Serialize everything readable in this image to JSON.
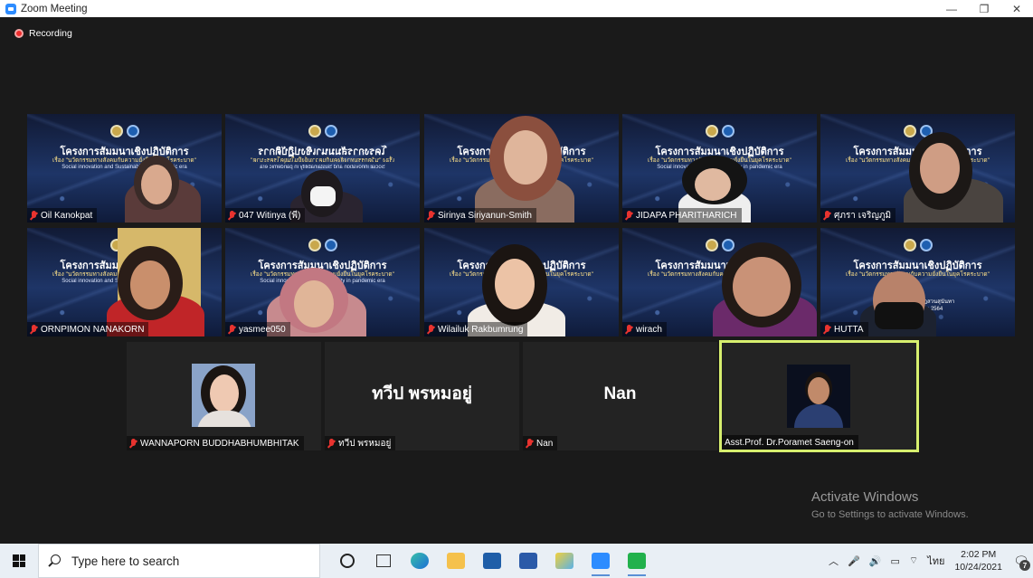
{
  "window": {
    "title": "Zoom Meeting",
    "controls": {
      "minimize": "—",
      "restore": "❐",
      "close": "✕"
    }
  },
  "recording": {
    "label": "Recording",
    "color": "#ee2c2c"
  },
  "slide": {
    "title": "โครงการสัมมนาเชิงปฏิบัติการ",
    "subtitle": "เรื่อง \"นวัตกรรมทางสังคมกับความยั่งยืนในยุคโรคระบาด\"",
    "english": "Social innovation and Sustainability in pandemic era",
    "venue": "มหาวิทยาลัยราชภัฏสวนสุนันทา",
    "date": "วันที่ 24 ตุลาคม 2564"
  },
  "participants_video": [
    {
      "name": "Oil Kanokpat",
      "muted": true
    },
    {
      "name": "047 Witinya (พี)",
      "muted": true
    },
    {
      "name": "Sirinya Siriyanun-Smith",
      "muted": true
    },
    {
      "name": "JIDAPA PHARITHARICH",
      "muted": true
    },
    {
      "name": "ศุภรา เจริญภูมิ",
      "muted": true
    },
    {
      "name": "ORNPIMON NANAKORN",
      "muted": true
    },
    {
      "name": "yasmee050",
      "muted": true
    },
    {
      "name": "Wilailuk Rakbumrung",
      "muted": true
    },
    {
      "name": "wirach",
      "muted": true
    },
    {
      "name": "HUTTA",
      "muted": true
    }
  ],
  "participants_bottom": [
    {
      "name": "WANNAPORN BUDDHABHUMBHITAK",
      "display": "",
      "muted": true
    },
    {
      "name": "ทวีป พรหมอยู่",
      "display": "ทวีป พรหมอยู่",
      "muted": true
    },
    {
      "name": "Nan",
      "display": "Nan",
      "muted": true
    },
    {
      "name": "Asst.Prof. Dr.Poramet Saeng-on",
      "display": "",
      "muted": false,
      "active_speaker": true
    }
  ],
  "activate": {
    "line1": "Activate Windows",
    "line2": "Go to Settings to activate Windows."
  },
  "taskbar": {
    "search_placeholder": "Type here to search",
    "apps": [
      "cortana-icon",
      "task-view-icon",
      "edge-icon",
      "file-explorer-icon",
      "mail-icon",
      "word-icon",
      "paint-icon",
      "zoom-icon",
      "line-icon"
    ],
    "tray": {
      "language": "ไทย",
      "time": "2:02 PM",
      "date": "10/24/2021",
      "notifications": "7"
    }
  },
  "colors": {
    "active_border": "#d7ef6e",
    "mic_muted": "#e8332f",
    "taskbar": "#e9eff5"
  }
}
